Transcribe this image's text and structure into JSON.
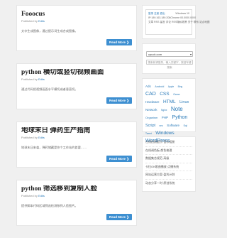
{
  "posts": [
    {
      "title": "Fooocus",
      "published_by": "Published by",
      "author": "Edits",
      "excerpt": "文字生成图像，通过提示词生成合成图像。",
      "read_more": "Read More ❯"
    },
    {
      "title": "python 横切或竖切视频画面",
      "published_by": "Published by",
      "author": "Edits",
      "excerpt": "通过代码把视频画面水平横切或者垂直切。",
      "read_more": "Read More ❯"
    },
    {
      "title": "地球末日 弹药生产指南",
      "published_by": "Published by",
      "author": "Edits",
      "excerpt": "地球末日来袭，弹药储藏是你个工作站的首要……",
      "read_more": "Read More ❯"
    },
    {
      "title": "python 筛选移到复制人脸",
      "published_by": "Published by",
      "author": "Edits",
      "excerpt": "提供脚本代码区域筛选检测移到人脸图片。",
      "read_more": "Read More ❯"
    }
  ],
  "calendar": {
    "rows": [
      [
        "登录 注册 退出",
        "Windows 10"
      ],
      [
        "IP:189.163.189.208",
        "Chrome 00.0000.0000"
      ],
      [
        "文章 RSS 留言 评论 RSS",
        "隐私政策 关于 联系 站点地图"
      ]
    ]
  },
  "search": {
    "selected": "cpuck.com",
    "placeholder": "搜索前请登录，输入关键字，按回车键搜索"
  },
  "tags": [
    {
      "text": "Ads",
      "size": 4.5
    },
    {
      "text": "Android",
      "size": 3.8
    },
    {
      "text": "Apple",
      "size": 3.3
    },
    {
      "text": "Bing",
      "size": 3.3
    },
    {
      "text": "CAD",
      "size": 7
    },
    {
      "text": "CSS",
      "size": 6.5
    },
    {
      "text": "Game",
      "size": 3.5
    },
    {
      "text": "Hardware",
      "size": 4.5
    },
    {
      "text": "HTML",
      "size": 6.5
    },
    {
      "text": "Linux",
      "size": 5.5
    },
    {
      "text": "Network",
      "size": 4.5
    },
    {
      "text": "Nginx",
      "size": 3.3
    },
    {
      "text": "Note",
      "size": 8
    },
    {
      "text": "Organism",
      "size": 4
    },
    {
      "text": "PHP",
      "size": 4.5
    },
    {
      "text": "Python",
      "size": 7
    },
    {
      "text": "Script",
      "size": 5.5
    },
    {
      "text": "seo",
      "size": 3.3
    },
    {
      "text": "Software",
      "size": 4.5
    },
    {
      "text": "Sql",
      "size": 3.8
    },
    {
      "text": "Tweet",
      "size": 3.3
    },
    {
      "text": "Windows",
      "size": 6.5
    },
    {
      "text": "WordPress",
      "size": 7
    }
  ],
  "links": [
    "在线拍照配乐·音乐相册",
    "在线调色板·颜色梳理",
    "数据集合规范·高级",
    "卡拉OK歌曲播放·点播系统",
    "网站运营方案·盈利计划",
    "动态分享一时·原创系统"
  ]
}
